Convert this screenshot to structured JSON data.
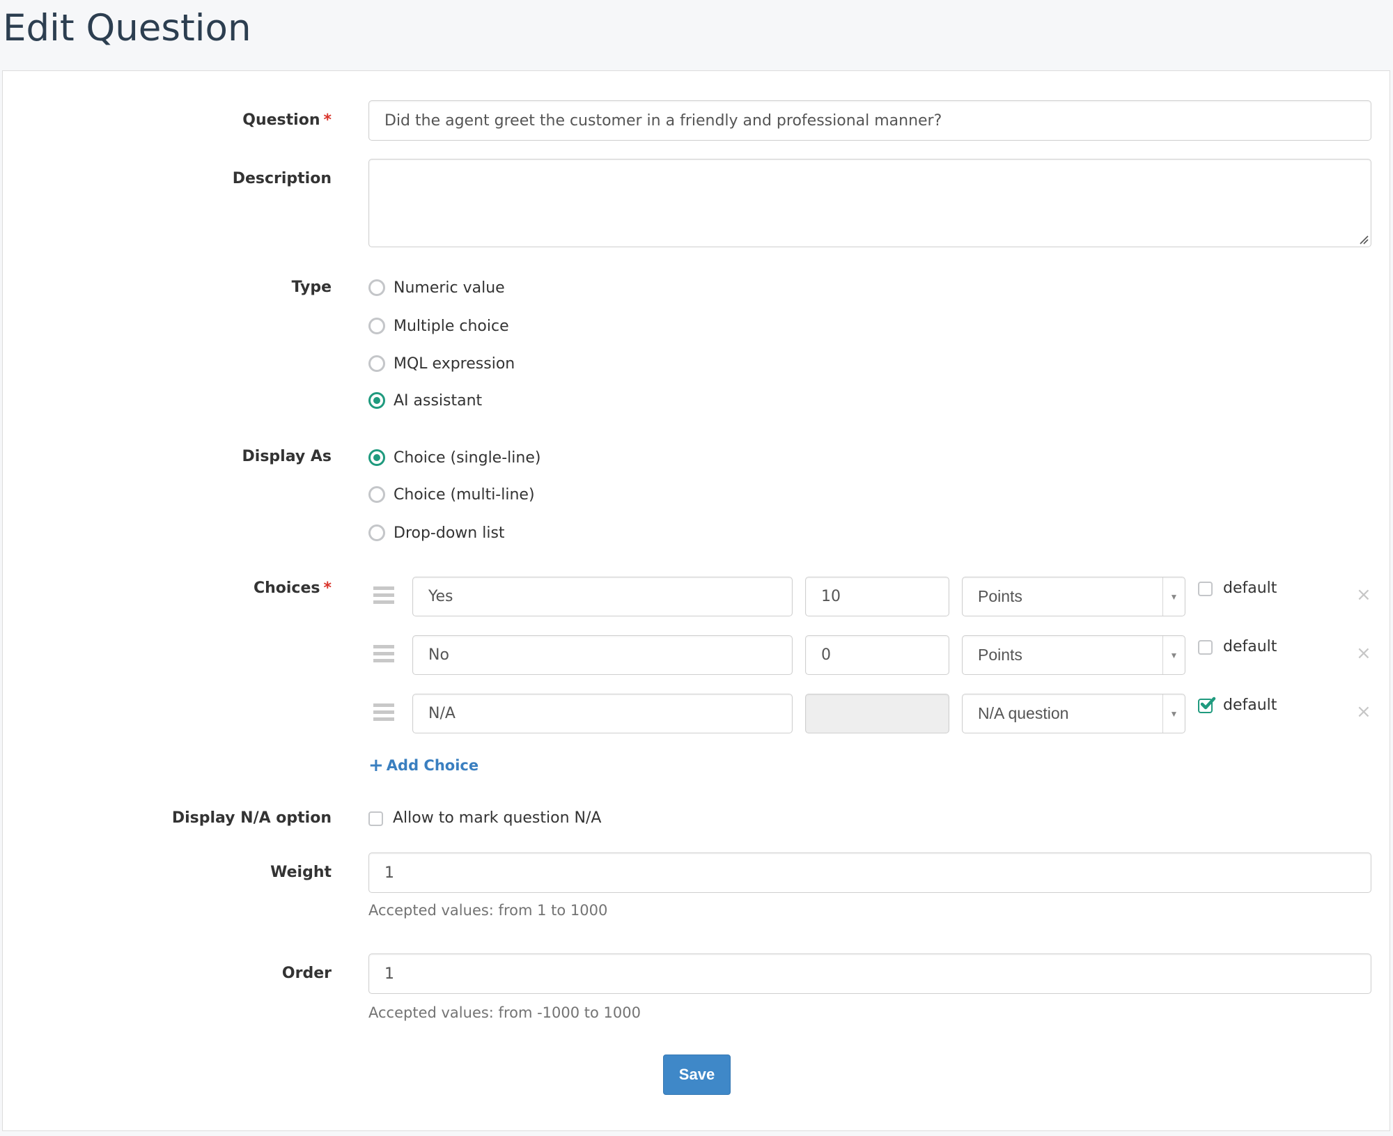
{
  "page": {
    "title": "Edit Question"
  },
  "colors": {
    "accent": "#1f9a7e",
    "link": "#3a7fc0",
    "primary_button": "#3f88c8",
    "required": "#d9342b"
  },
  "form": {
    "question": {
      "label": "Question",
      "required_mark": "*",
      "value": "Did the agent greet the customer in a friendly and professional manner?"
    },
    "description": {
      "label": "Description",
      "value": ""
    },
    "type": {
      "label": "Type",
      "options": [
        {
          "label": "Numeric value",
          "checked": false
        },
        {
          "label": "Multiple choice",
          "checked": false
        },
        {
          "label": "MQL expression",
          "checked": false
        },
        {
          "label": "AI assistant",
          "checked": true
        }
      ]
    },
    "display_as": {
      "label": "Display As",
      "options": [
        {
          "label": "Choice (single-line)",
          "checked": true
        },
        {
          "label": "Choice (multi-line)",
          "checked": false
        },
        {
          "label": "Drop-down list",
          "checked": false
        }
      ]
    },
    "choices": {
      "label": "Choices",
      "required_mark": "*",
      "items": [
        {
          "text": "Yes",
          "score": "10",
          "score_type": "Points",
          "default_label": "default",
          "is_default": false,
          "score_disabled": false,
          "remove_icon": "close-icon"
        },
        {
          "text": "No",
          "score": "0",
          "score_type": "Points",
          "default_label": "default",
          "is_default": false,
          "score_disabled": false,
          "remove_icon": "close-icon"
        },
        {
          "text": "N/A",
          "score": "",
          "score_type": "N/A question",
          "default_label": "default",
          "is_default": true,
          "score_disabled": true,
          "remove_icon": "close-icon"
        }
      ],
      "add_label": "Add Choice",
      "add_icon": "plus-icon",
      "drag_icon": "drag-handle-icon",
      "dropdown_icon": "caret-down-icon"
    },
    "display_na": {
      "label": "Display N/A option",
      "checkbox_label": "Allow to mark question N/A",
      "checked": false
    },
    "weight": {
      "label": "Weight",
      "value": "1",
      "help": "Accepted values: from 1 to 1000"
    },
    "order": {
      "label": "Order",
      "value": "1",
      "help": "Accepted values: from -1000 to 1000"
    },
    "save_label": "Save"
  }
}
